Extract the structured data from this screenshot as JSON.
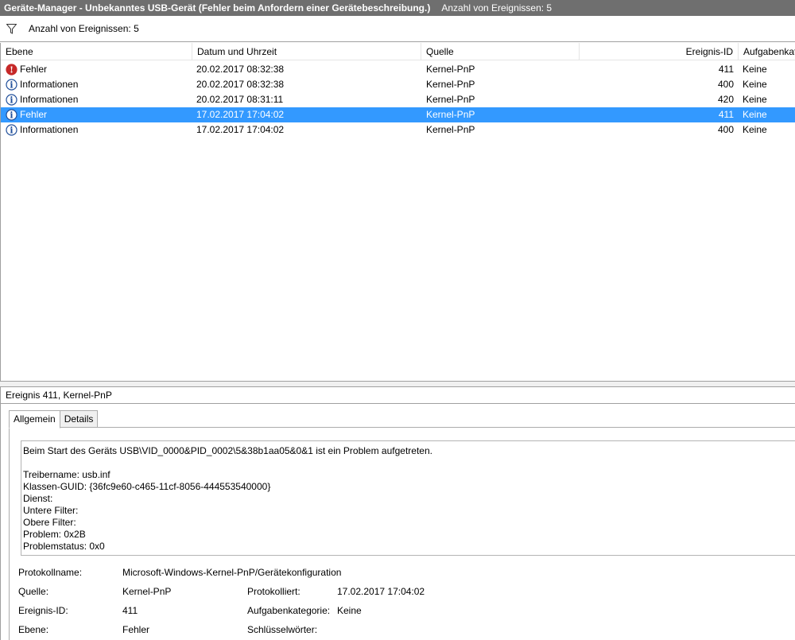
{
  "titlebar": {
    "title": "Geräte-Manager - Unbekanntes USB-Gerät (Fehler beim Anfordern einer Gerätebeschreibung.)",
    "count": "Anzahl von Ereignissen: 5"
  },
  "filterbar": {
    "icon": "filter-icon",
    "label": "Anzahl von Ereignissen: 5"
  },
  "columns": {
    "level": "Ebene",
    "date": "Datum und Uhrzeit",
    "source": "Quelle",
    "event_id": "Ereignis-ID",
    "task": "Aufgabenkat"
  },
  "events": [
    {
      "level": "Fehler",
      "icon": "error-icon",
      "date": "20.02.2017 08:32:38",
      "source": "Kernel-PnP",
      "event_id": "411",
      "task": "Keine"
    },
    {
      "level": "Informationen",
      "icon": "info-icon",
      "date": "20.02.2017 08:32:38",
      "source": "Kernel-PnP",
      "event_id": "400",
      "task": "Keine"
    },
    {
      "level": "Informationen",
      "icon": "info-icon",
      "date": "20.02.2017 08:31:11",
      "source": "Kernel-PnP",
      "event_id": "420",
      "task": "Keine"
    },
    {
      "level": "Fehler",
      "icon": "info-icon",
      "date": "17.02.2017 17:04:02",
      "source": "Kernel-PnP",
      "event_id": "411",
      "task": "Keine"
    },
    {
      "level": "Informationen",
      "icon": "info-icon",
      "date": "17.02.2017 17:04:02",
      "source": "Kernel-PnP",
      "event_id": "400",
      "task": "Keine"
    }
  ],
  "selected_row": 3,
  "detail": {
    "header": "Ereignis 411, Kernel-PnP",
    "tabs": [
      "Allgemein",
      "Details"
    ],
    "active_tab": "Allgemein",
    "message_lines": [
      "Beim Start des Geräts USB\\VID_0000&PID_0002\\5&38b1aa05&0&1 ist ein Problem aufgetreten.",
      "",
      "Treibername: usb.inf",
      "Klassen-GUID: {36fc9e60-c465-11cf-8056-444553540000}",
      "Dienst:",
      "Untere Filter:",
      "Obere Filter:",
      "Problem: 0x2B",
      "Problemstatus: 0x0"
    ],
    "properties": {
      "log_name_label": "Protokollname:",
      "log_name_value": "Microsoft-Windows-Kernel-PnP/Gerätekonfiguration",
      "source_label": "Quelle:",
      "source_value": "Kernel-PnP",
      "logged_label": "Protokolliert:",
      "logged_value": "17.02.2017 17:04:02",
      "event_id_label": "Ereignis-ID:",
      "event_id_value": "411",
      "task_label": "Aufgabenkategorie:",
      "task_value": "Keine",
      "level_label": "Ebene:",
      "level_value": "Fehler",
      "keywords_label": "Schlüsselwörter:",
      "keywords_value": ""
    }
  },
  "colors": {
    "titlebar_bg": "#6f6f6f",
    "selection": "#3399ff",
    "error_icon": "#c62828",
    "info_icon": "#1f4e9a"
  }
}
